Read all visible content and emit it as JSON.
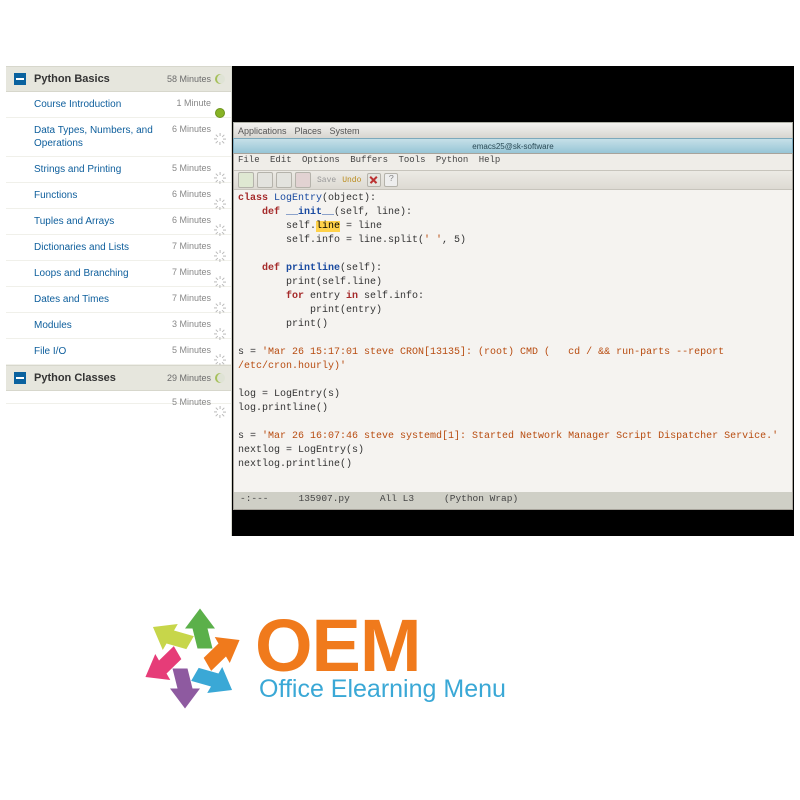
{
  "sidebar": {
    "sections": [
      {
        "title": "Python Basics",
        "duration": "58 Minutes",
        "items": [
          {
            "label": "Course Introduction",
            "duration": "1 Minute",
            "status": "done"
          },
          {
            "label": "Data Types, Numbers, and Operations",
            "duration": "6 Minutes",
            "status": "loading"
          },
          {
            "label": "Strings and Printing",
            "duration": "5 Minutes",
            "status": "loading"
          },
          {
            "label": "Functions",
            "duration": "6 Minutes",
            "status": "loading"
          },
          {
            "label": "Tuples and Arrays",
            "duration": "6 Minutes",
            "status": "loading"
          },
          {
            "label": "Dictionaries and Lists",
            "duration": "7 Minutes",
            "status": "loading"
          },
          {
            "label": "Loops and Branching",
            "duration": "7 Minutes",
            "status": "loading"
          },
          {
            "label": "Dates and Times",
            "duration": "7 Minutes",
            "status": "loading"
          },
          {
            "label": "Modules",
            "duration": "3 Minutes",
            "status": "loading"
          },
          {
            "label": "File I/O",
            "duration": "5 Minutes",
            "status": "loading"
          }
        ]
      },
      {
        "title": "Python Classes",
        "duration": "29 Minutes",
        "items": [
          {
            "label": "",
            "duration": "5 Minutes",
            "status": "loading"
          }
        ]
      }
    ]
  },
  "gnome": {
    "menus": [
      "Applications",
      "Places",
      "System"
    ]
  },
  "window": {
    "title": "emacs25@sk-software"
  },
  "emacs": {
    "menus": [
      "File",
      "Edit",
      "Options",
      "Buffers",
      "Tools",
      "Python",
      "Help"
    ],
    "toolbar": {
      "save": "Save",
      "undo": "Undo",
      "q": "?"
    },
    "code": {
      "l1a": "class ",
      "l1b": "LogEntry",
      "l1c": "(object):",
      "l2a": "    def ",
      "l2b": "__init__",
      "l2c": "(self, line):",
      "l3a": "        self.",
      "l3b": "line",
      "l3c": " = line",
      "l4a": "        self.info = line.split(",
      "l4b": "' '",
      "l4c": ", 5)",
      "l5": "",
      "l6a": "    def ",
      "l6b": "printline",
      "l6c": "(self):",
      "l7a": "        print(self.line)",
      "l8a": "        for ",
      "l8b": "entry ",
      "l8c": "in ",
      "l8d": "self.info:",
      "l9": "            print(entry)",
      "l10": "        print()",
      "l11": "",
      "l12a": "s = ",
      "l12b": "'Mar 26 15:17:01 steve CRON[13135]: (root) CMD (   cd / && run-parts --report",
      "l12c": "/etc/cron.hourly)'",
      "l13": "",
      "l14": "log = LogEntry(s)",
      "l15": "log.printline()",
      "l16": "",
      "l17a": "s = ",
      "l17b": "'Mar 26 16:07:46 steve systemd[1]: Started Network Manager Script Dispatcher Service.'",
      "l18": "nextlog = LogEntry(s)",
      "l19": "nextlog.printline()"
    },
    "modeline": {
      "left": "-:---",
      "file": "135907.py",
      "pos": "All L3",
      "mode": "(Python Wrap)"
    }
  },
  "brand": {
    "title": "OEM",
    "subtitle": "Office Elearning Menu"
  }
}
